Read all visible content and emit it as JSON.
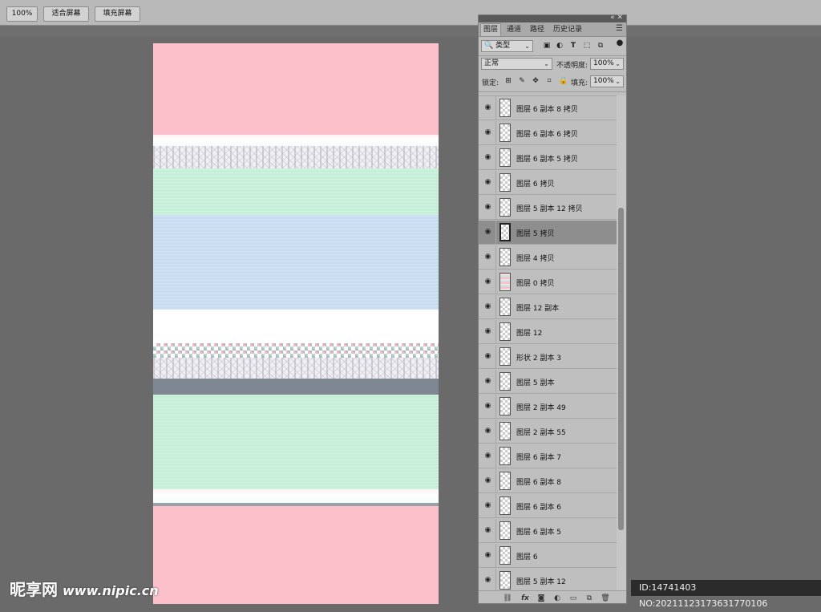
{
  "toolbar": {
    "zoom_label": "100%",
    "fit_screen_label": "适合屏幕",
    "fill_screen_label": "填充屏幕"
  },
  "panel": {
    "tabs": [
      "图层",
      "通道",
      "路径",
      "历史记录"
    ],
    "active_tab": "图层",
    "filter_label": "类型",
    "blend_mode": "正常",
    "opacity_label": "不透明度:",
    "opacity_value": "100%",
    "lock_label": "锁定:",
    "fill_label": "填充:",
    "fill_value": "100%",
    "selected_layer": "图层 5 拷贝",
    "layers": [
      {
        "name": "图层 6 副本 8 拷贝"
      },
      {
        "name": "图层 6 副本 6 拷贝"
      },
      {
        "name": "图层 6 副本 5 拷贝"
      },
      {
        "name": "图层 6 拷贝"
      },
      {
        "name": "图层 5 副本 12 拷贝"
      },
      {
        "name": "图层 5 拷贝"
      },
      {
        "name": "图层 4 拷贝"
      },
      {
        "name": "图层 0 拷贝"
      },
      {
        "name": "图层 12 副本"
      },
      {
        "name": "图层 12"
      },
      {
        "name": "形状 2 副本 3"
      },
      {
        "name": "图层 5 副本"
      },
      {
        "name": "图层 2 副本 49"
      },
      {
        "name": "图层 2 副本 55"
      },
      {
        "name": "图层 6 副本 7"
      },
      {
        "name": "图层 6 副本 8"
      },
      {
        "name": "图层 6 副本 6"
      },
      {
        "name": "图层 6 副本 5"
      },
      {
        "name": "图层 6"
      },
      {
        "name": "图层 5 副本 12"
      }
    ]
  },
  "watermark": {
    "brand": "昵享网",
    "url": "www.nipic.cn",
    "id_text": "ID:14741403 NO:20211123173631770106"
  },
  "colors": {
    "pink": "#fcc0cb",
    "green": "#c6efd9",
    "blue": "#c8dcf2",
    "workspace": "#6a6a6a",
    "panel": "#bfbfbf"
  }
}
